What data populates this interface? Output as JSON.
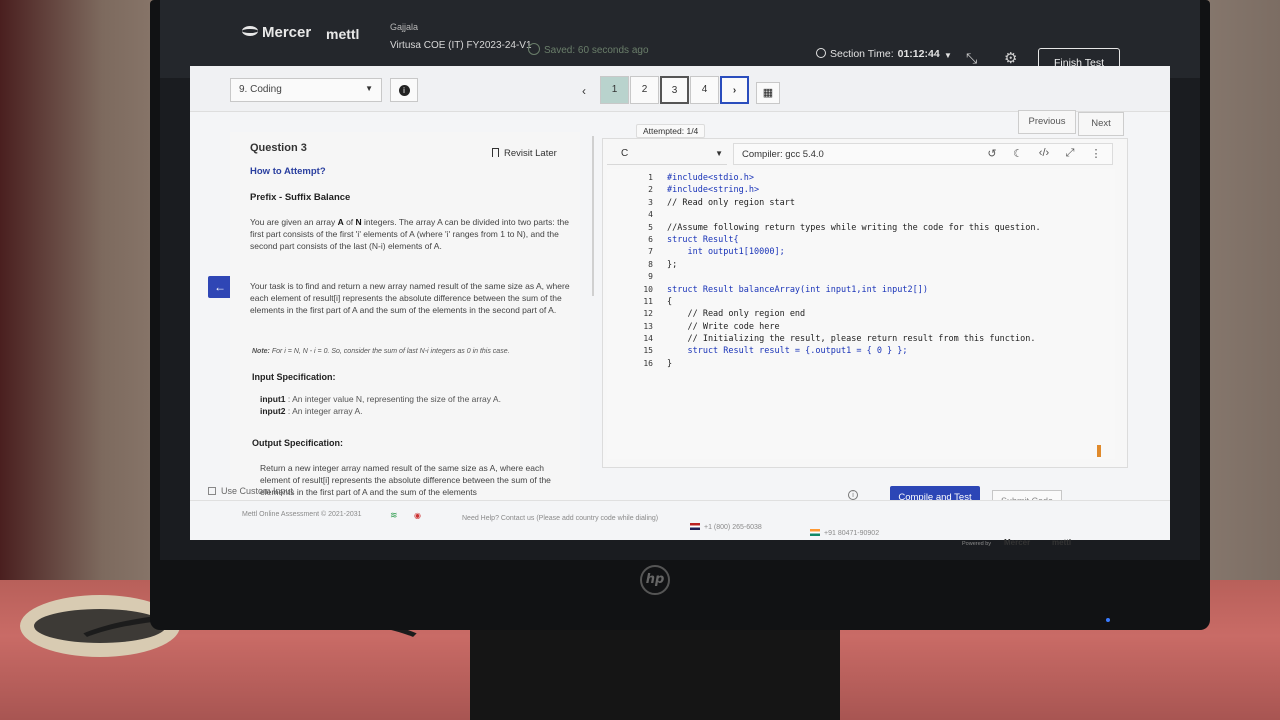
{
  "header": {
    "brand": "Mercer",
    "brand_secondary": "mettl",
    "user_name": "Gajjala",
    "test_title": "Virtusa COE (IT) FY2023-24-V1",
    "saved_status": "Saved: 60 seconds ago",
    "section_time_label": "Section Time:",
    "section_time_value": "01:12:44",
    "finish_label": "Finish Test"
  },
  "nav": {
    "section": "9. Coding",
    "questions": [
      "1",
      "2",
      "3",
      "4"
    ],
    "next_symbol": "›",
    "prev_symbol": "‹",
    "attempted": "Attempted: 1/4",
    "previous_label": "Previous",
    "next_label": "Next"
  },
  "question": {
    "title": "Question 3",
    "revisit": "Revisit Later",
    "how_to": "How to Attempt?",
    "heading": "Prefix - Suffix Balance",
    "para1_a": "You are given an array ",
    "para1_A": "A",
    "para1_b": " of ",
    "para1_N": "N",
    "para1_c": " integers. The array A can be divided into two parts: the first part consists of the first 'i' elements of A (where 'i' ranges from 1 to N), and the second part consists of the last (N-i) elements of A.",
    "para2": "Your task is to find and return a new array named result of the same size as A, where each element of result[i] represents the absolute difference between the sum of the elements in the first part of A and the sum of the elements in the second part of A.",
    "note_label": "Note:",
    "note_text": " For i = N, N - i = 0. So, consider the sum of last N-i integers as 0 in this case.",
    "input_spec": "Input Specification:",
    "input1_name": "input1",
    "input1_desc": " : An integer value N, representing the size of the array A.",
    "input2_name": "input2",
    "input2_desc": " : An integer array A.",
    "output_spec": "Output Specification:",
    "output_text": "Return a new integer array named result of the same size as A, where each element of result[i] represents the absolute difference between the sum of the elements in the first part of A and the sum of the elements"
  },
  "editor": {
    "language": "C",
    "compiler": "Compiler: gcc 5.4.0",
    "lines": [
      "#include<stdio.h>",
      "#include<string.h>",
      "// Read only region start",
      "",
      "//Assume following return types while writing the code for this question.",
      "struct Result{",
      "    int output1[10000];",
      "};",
      "",
      "struct Result balanceArray(int input1,int input2[])",
      "{",
      "    // Read only region end",
      "    // Write code here",
      "    // Initializing the result, please return result from this function.",
      "    struct Result result = {.output1 = { 0 } };",
      "}"
    ],
    "line_numbers": [
      "1",
      "2",
      "3",
      "4",
      "5",
      "6",
      "7",
      "8",
      "9",
      "10",
      "11",
      "12",
      "13",
      "14",
      "15",
      "16"
    ],
    "custom_input": "Use Custom Input",
    "compile_label": "Compile and Test",
    "submit_label": "Submit Code"
  },
  "footer": {
    "copyright": "Mettl Online Assessment © 2021-2031",
    "help": "Need Help? Contact us (Please add country code while dialing)",
    "phone_us": "+1 (800) 265-6038",
    "phone_in": "+91 80471-90902",
    "powered_by": "Powered by",
    "brand": "Mercer",
    "brand_secondary": "mettl"
  },
  "colors": {
    "primary": "#2c46b6",
    "answered": "#b9d3cd",
    "accent": "#e08a2c"
  }
}
